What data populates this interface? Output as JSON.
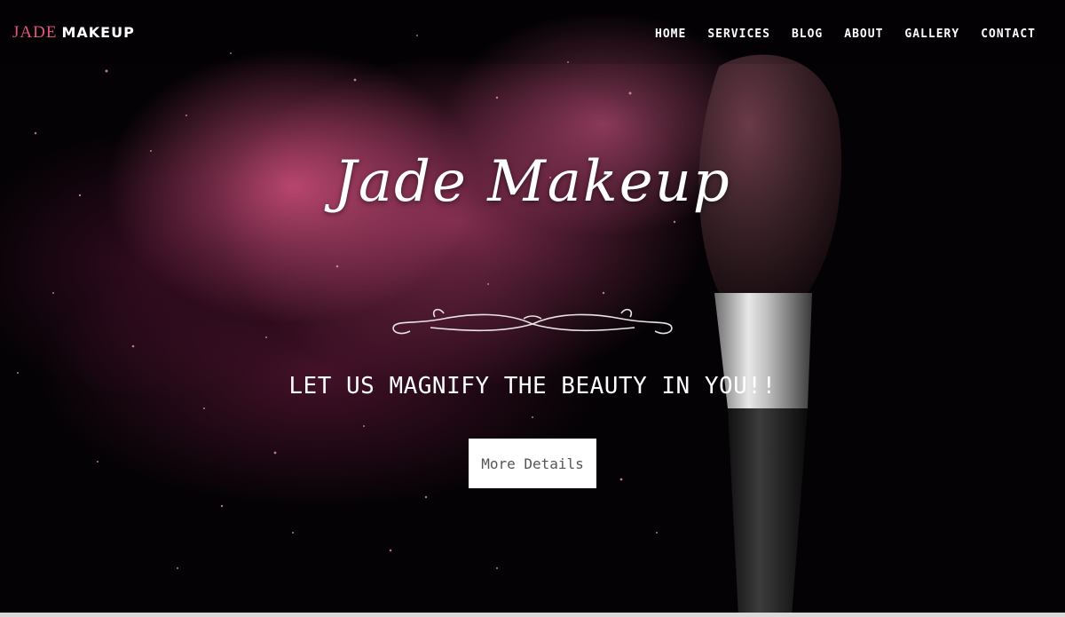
{
  "brand": {
    "part1": "JADE",
    "part2": "MAKEUP"
  },
  "nav": {
    "home": "HOME",
    "services": "SERVICES",
    "blog": "BLOG",
    "about": "ABOUT",
    "gallery": "GALLERY",
    "contact": "CONTACT"
  },
  "hero": {
    "title": "Jade Makeup",
    "tagline": "LET US MAGNIFY THE BEAUTY IN YOU!!",
    "button_label": "More Details"
  },
  "colors": {
    "accent": "#e0567f",
    "background": "#050205",
    "button_bg": "#ffffff",
    "button_text": "#555555"
  },
  "icons": {
    "brush": "makeup-brush-image",
    "flourish": "ornamental-flourish-divider"
  }
}
